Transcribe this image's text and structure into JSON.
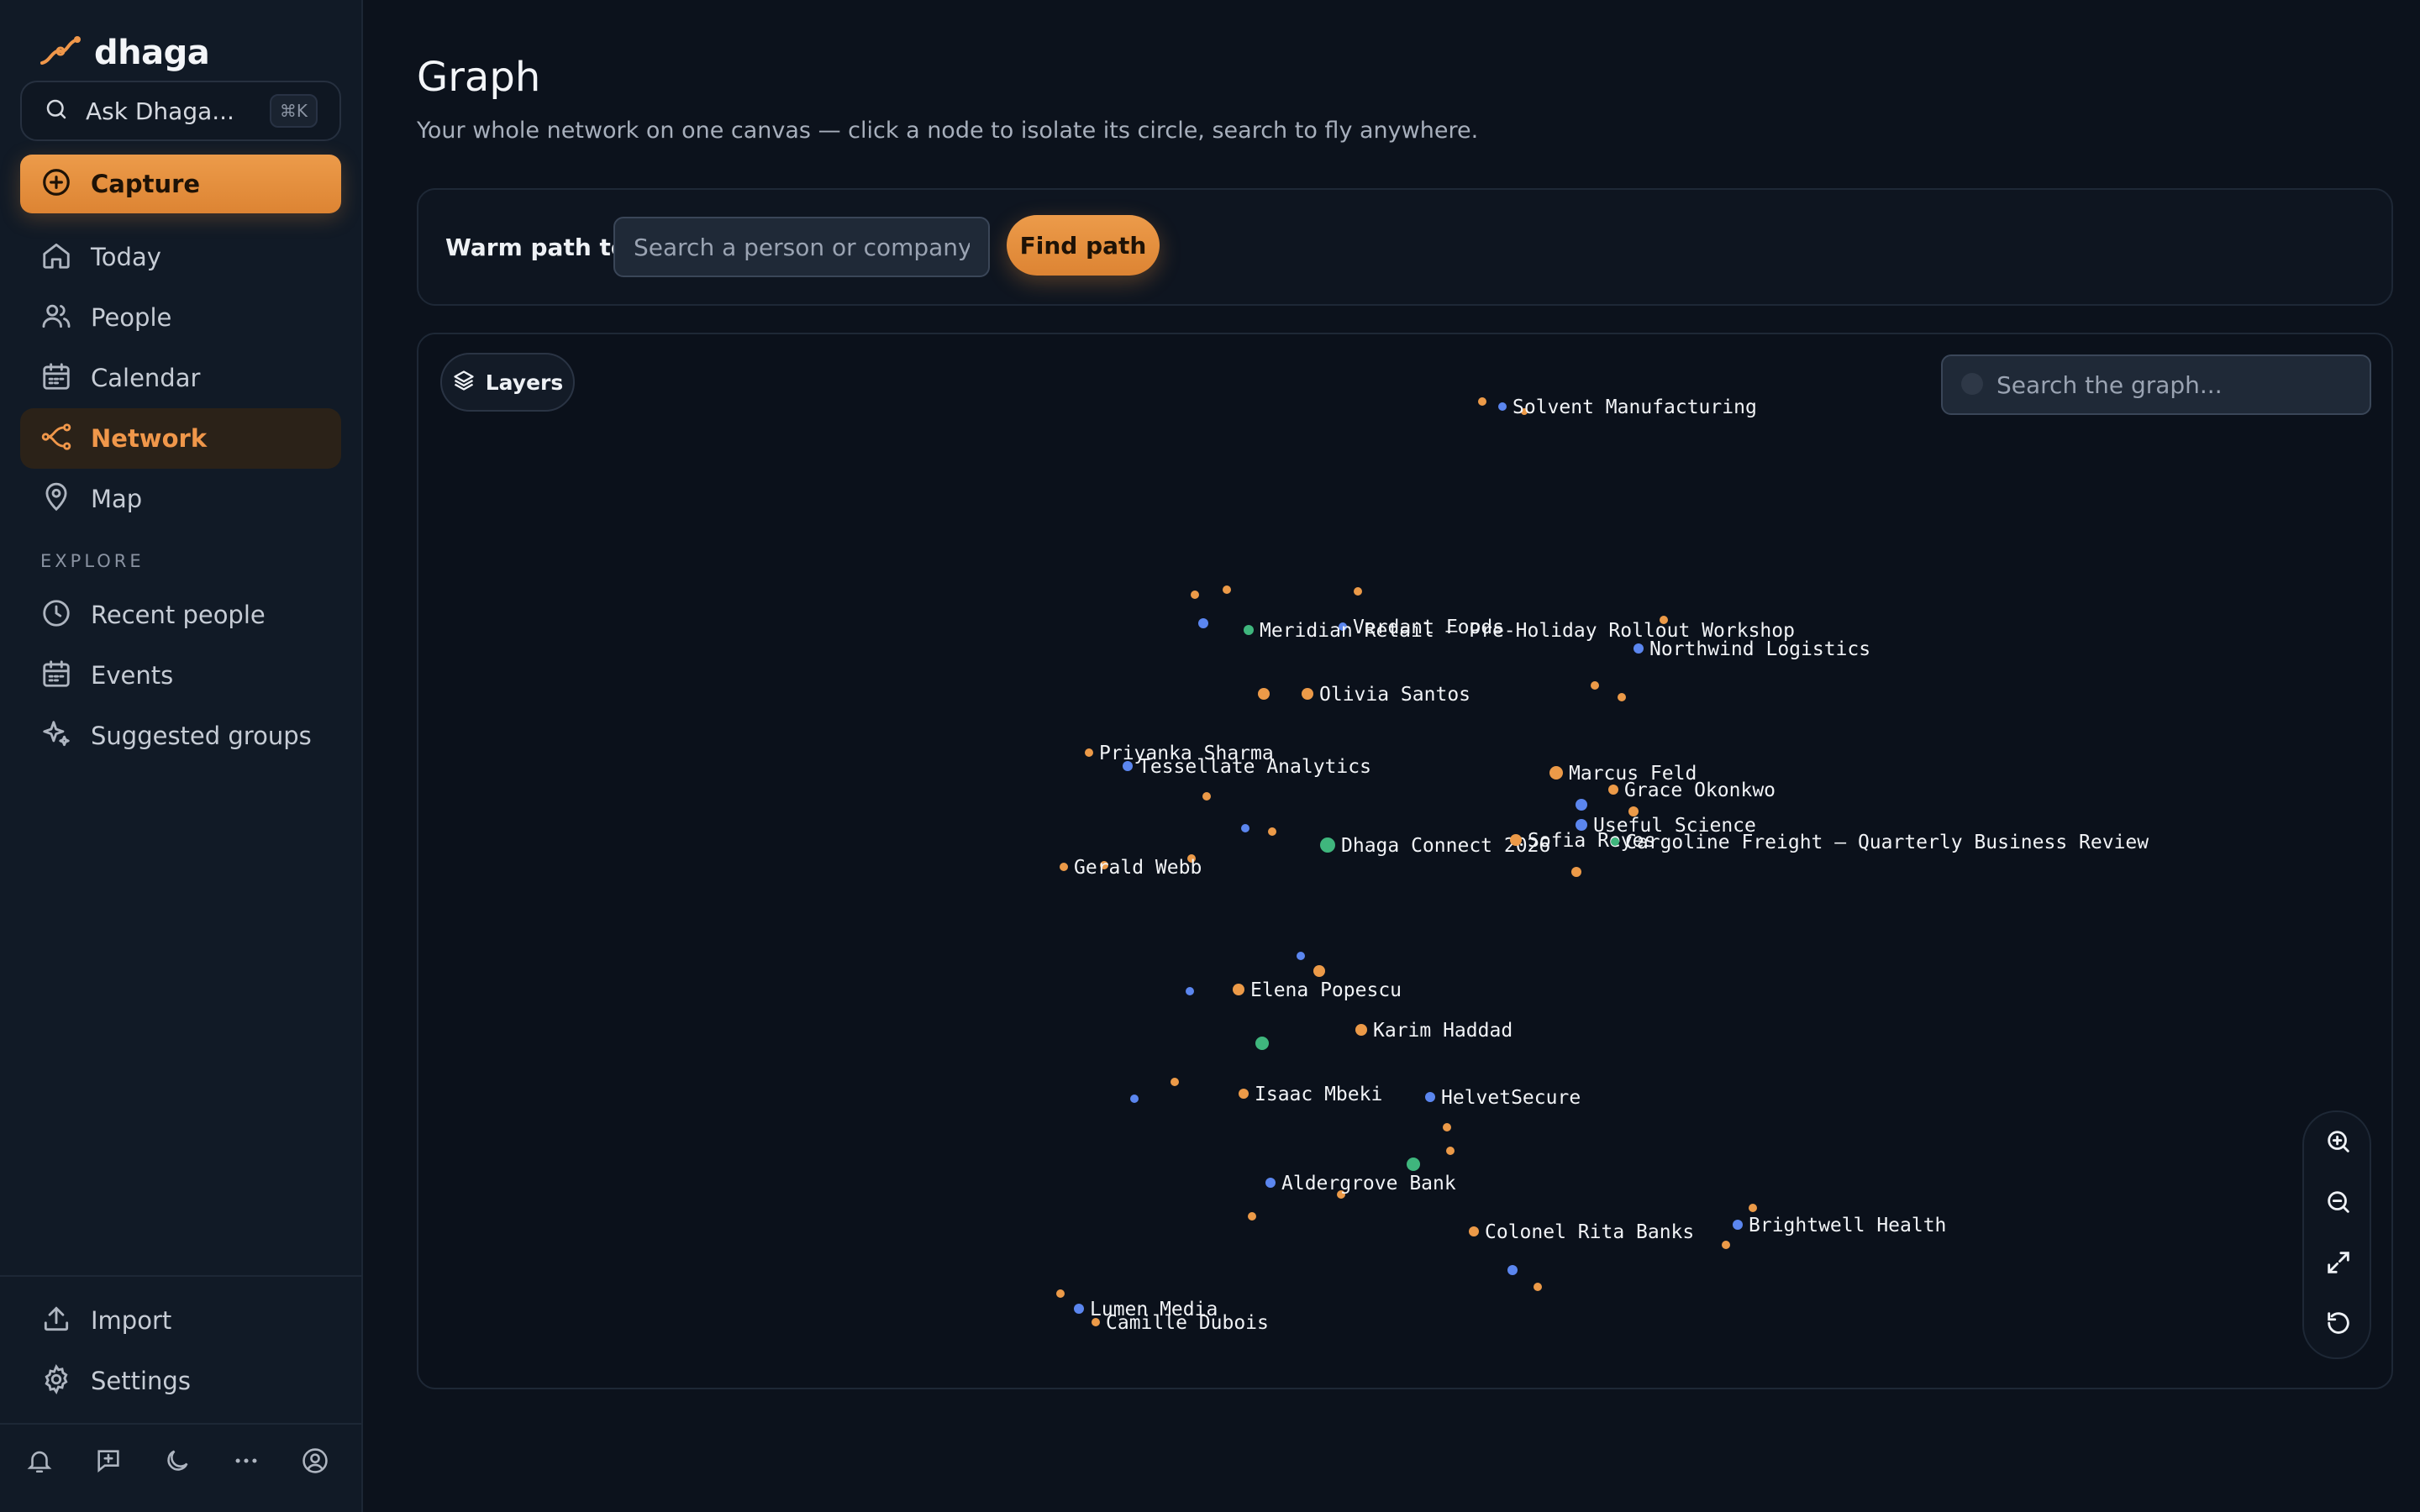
{
  "app": {
    "brand": "dhaga",
    "accent": "#f0974a"
  },
  "sidebar": {
    "ask": {
      "label": "Ask Dhaga...",
      "shortcut": "⌘K",
      "icon": "search-icon"
    },
    "capture": {
      "label": "Capture",
      "icon": "plus-circle-icon"
    },
    "nav": [
      {
        "label": "Today",
        "icon": "home-icon",
        "active": false
      },
      {
        "label": "People",
        "icon": "people-icon",
        "active": false
      },
      {
        "label": "Calendar",
        "icon": "calendar-icon",
        "active": false
      },
      {
        "label": "Network",
        "icon": "network-icon",
        "active": true
      },
      {
        "label": "Map",
        "icon": "map-pin-icon",
        "active": false
      }
    ],
    "explore_label": "EXPLORE",
    "explore": [
      {
        "label": "Recent people",
        "icon": "clock-icon"
      },
      {
        "label": "Events",
        "icon": "calendar-icon"
      },
      {
        "label": "Suggested groups",
        "icon": "sparkles-icon"
      }
    ],
    "bottom": [
      {
        "label": "Import",
        "icon": "upload-icon"
      },
      {
        "label": "Settings",
        "icon": "gear-icon"
      }
    ],
    "footer_icons": [
      "bell-icon",
      "message-plus-icon",
      "moon-icon",
      "more-icon",
      "account-icon"
    ]
  },
  "page": {
    "title": "Graph",
    "subtitle": "Your whole network on one canvas — click a node to isolate its circle, search to fly anywhere."
  },
  "warm_path": {
    "label": "Warm path to",
    "placeholder": "Search a person or company...",
    "button": "Find path"
  },
  "graph": {
    "layers_label": "Layers",
    "search_placeholder": "Search the graph...",
    "zoom_controls": [
      "zoom-in-icon",
      "zoom-out-icon",
      "fit-icon",
      "reset-icon"
    ],
    "colors": {
      "person": "#ec9a48",
      "company": "#5b86ef",
      "event": "#3fb67d"
    },
    "labeled_nodes": [
      {
        "label": "Solvent Manufacturing",
        "type": "company"
      },
      {
        "label": "Verdant Foods",
        "type": "company"
      },
      {
        "label": "Meridian Retail — Pre-Holiday Rollout Workshop",
        "type": "event"
      },
      {
        "label": "Northwind Logistics",
        "type": "company"
      },
      {
        "label": "Olivia Santos",
        "type": "person"
      },
      {
        "label": "Priyanka Sharma",
        "type": "person"
      },
      {
        "label": "Tessellate Analytics",
        "type": "company"
      },
      {
        "label": "Marcus Feld",
        "type": "person"
      },
      {
        "label": "Grace Okonkwo",
        "type": "person"
      },
      {
        "label": "Dhaga Connect 2026",
        "type": "event"
      },
      {
        "label": "Sofia Reyes",
        "type": "person"
      },
      {
        "label": "Useful Science",
        "type": "company"
      },
      {
        "label": "Cargoline Freight — Quarterly Business Review",
        "type": "event"
      },
      {
        "label": "Gerald Webb",
        "type": "person"
      },
      {
        "label": "Elena Popescu",
        "type": "person"
      },
      {
        "label": "Karim Haddad",
        "type": "person"
      },
      {
        "label": "Isaac Mbeki",
        "type": "person"
      },
      {
        "label": "HelvetSecure",
        "type": "company"
      },
      {
        "label": "Aldergrove Bank",
        "type": "company"
      },
      {
        "label": "Colonel Rita Banks",
        "type": "person"
      },
      {
        "label": "Brightwell Health",
        "type": "company"
      },
      {
        "label": "Lumen Media",
        "type": "company"
      },
      {
        "label": "Camille Dubois",
        "type": "person"
      }
    ]
  }
}
